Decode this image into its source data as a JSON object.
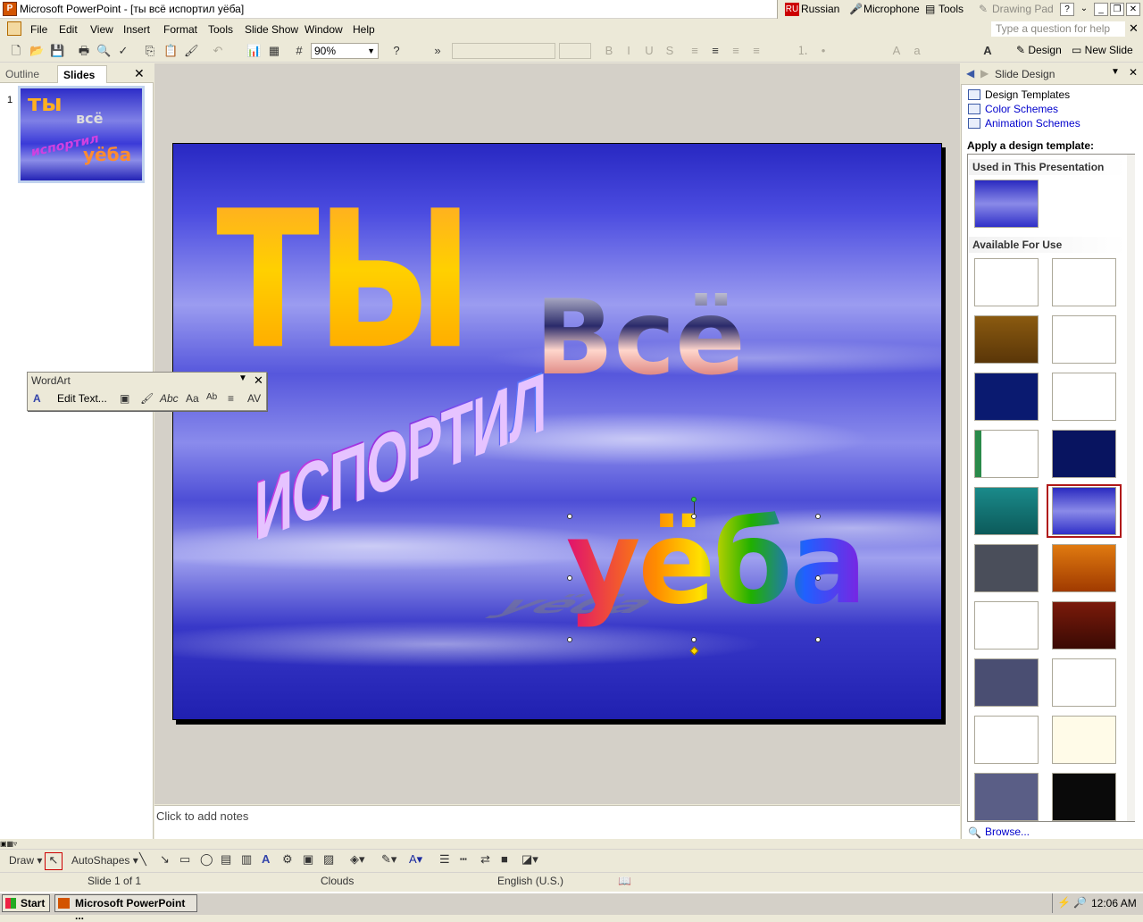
{
  "window": {
    "title": "Microsoft PowerPoint - [ты всё испортил уёба]",
    "app_icon": "P"
  },
  "langbar": {
    "code": "RU",
    "language": "Russian",
    "microphone": "Microphone",
    "tools": "Tools",
    "drawing_pad": "Drawing Pad"
  },
  "menu": {
    "items": [
      "File",
      "Edit",
      "View",
      "Insert",
      "Format",
      "Tools",
      "Slide Show",
      "Window",
      "Help"
    ],
    "help_placeholder": "Type a question for help"
  },
  "toolbar": {
    "zoom": "90%",
    "design_label": "Design",
    "new_slide_label": "New Slide"
  },
  "left_pane": {
    "tab_outline": "Outline",
    "tab_slides": "Slides",
    "slide_number": "1",
    "thumb_words": [
      "ты",
      "всё",
      "испортил",
      "уёба"
    ]
  },
  "slide": {
    "words": {
      "ty": "ТЫ",
      "vse": "Всё",
      "isportil": "ИСПОРТИЛ",
      "yoba": "уёба"
    }
  },
  "wordart_toolbar": {
    "title": "WordArt",
    "edit_text": "Edit Text...",
    "buttons": [
      "Aa",
      "Ab",
      "AV"
    ]
  },
  "notes": {
    "placeholder": "Click to add notes"
  },
  "task_pane": {
    "title": "Slide Design",
    "links": [
      "Design Templates",
      "Color Schemes",
      "Animation Schemes"
    ],
    "apply_label": "Apply a design template:",
    "used_header": "Used in This Presentation",
    "available_header": "Available For Use",
    "browse": "Browse..."
  },
  "drawbar": {
    "draw": "Draw",
    "autoshapes": "AutoShapes"
  },
  "status": {
    "slide": "Slide 1 of 1",
    "design": "Clouds",
    "language": "English (U.S.)"
  },
  "taskbar": {
    "start": "Start",
    "task": "Microsoft PowerPoint ...",
    "clock": "12:06 AM"
  },
  "colors": {
    "accent_link": "#0000cc",
    "slide_bg": "#3a3ad0",
    "selected_template_border": "#b01818"
  }
}
